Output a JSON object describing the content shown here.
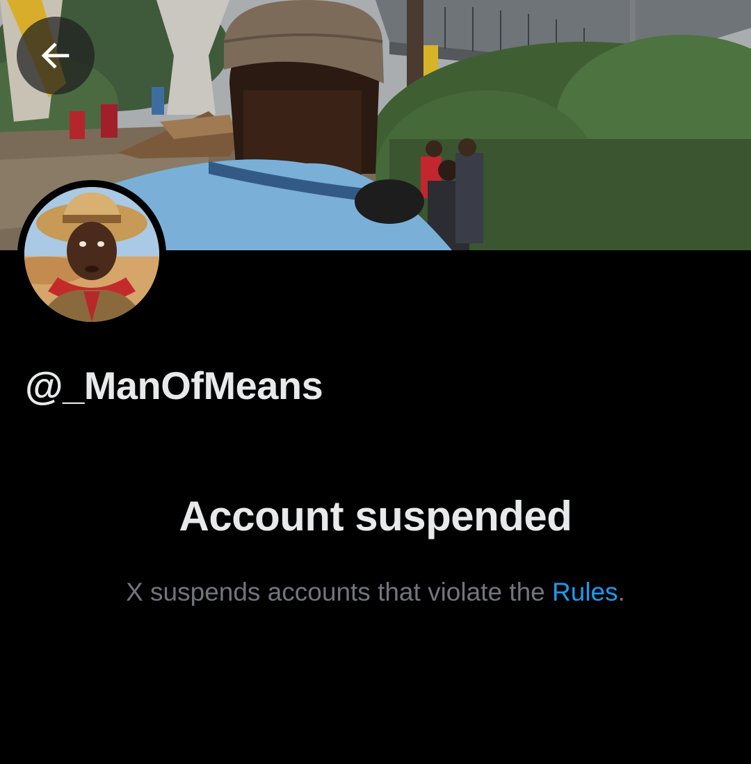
{
  "header": {
    "back_icon": "arrow-left-icon"
  },
  "profile": {
    "handle": "@_ManOfMeans",
    "avatar_icon": "profile-avatar",
    "banner_icon": "profile-banner-photo"
  },
  "suspension": {
    "title": "Account suspended",
    "description_prefix": "X suspends accounts that violate the ",
    "rules_link": "Rules",
    "description_suffix": "."
  },
  "colors": {
    "background": "#000000",
    "primary_text": "#e7e9ea",
    "secondary_text": "#71767b",
    "link": "#1d9bf0"
  }
}
